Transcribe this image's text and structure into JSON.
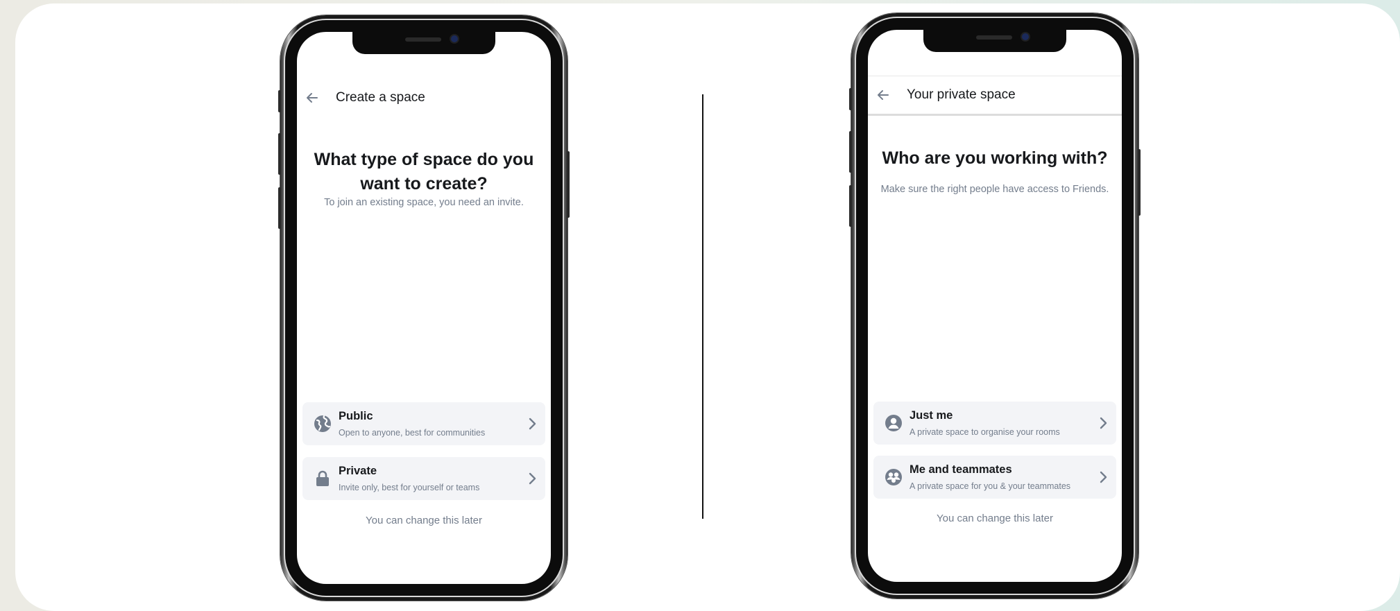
{
  "screens": [
    {
      "header_title": "Create a space",
      "heading": "What type of space do you want to create?",
      "subtext": "To join an existing space, you need an invite.",
      "options": [
        {
          "title": "Public",
          "description": "Open to anyone, best for communities",
          "icon": "globe-icon"
        },
        {
          "title": "Private",
          "description": "Invite only, best for yourself or teams",
          "icon": "lock-icon"
        }
      ],
      "footnote": "You can change this later"
    },
    {
      "header_title": "Your private space",
      "heading": "Who are you working with?",
      "subtext": "Make sure the right people have access to Friends.",
      "options": [
        {
          "title": "Just me",
          "description": "A private space to organise your rooms",
          "icon": "person-icon"
        },
        {
          "title": "Me and teammates",
          "description": "A private space for you & your teammates",
          "icon": "group-icon"
        }
      ],
      "footnote": "You can change this later"
    }
  ],
  "colors": {
    "text_primary": "#17191c",
    "text_secondary": "#737d8c",
    "option_background": "#f3f4f7",
    "icon": "#737d8c"
  }
}
